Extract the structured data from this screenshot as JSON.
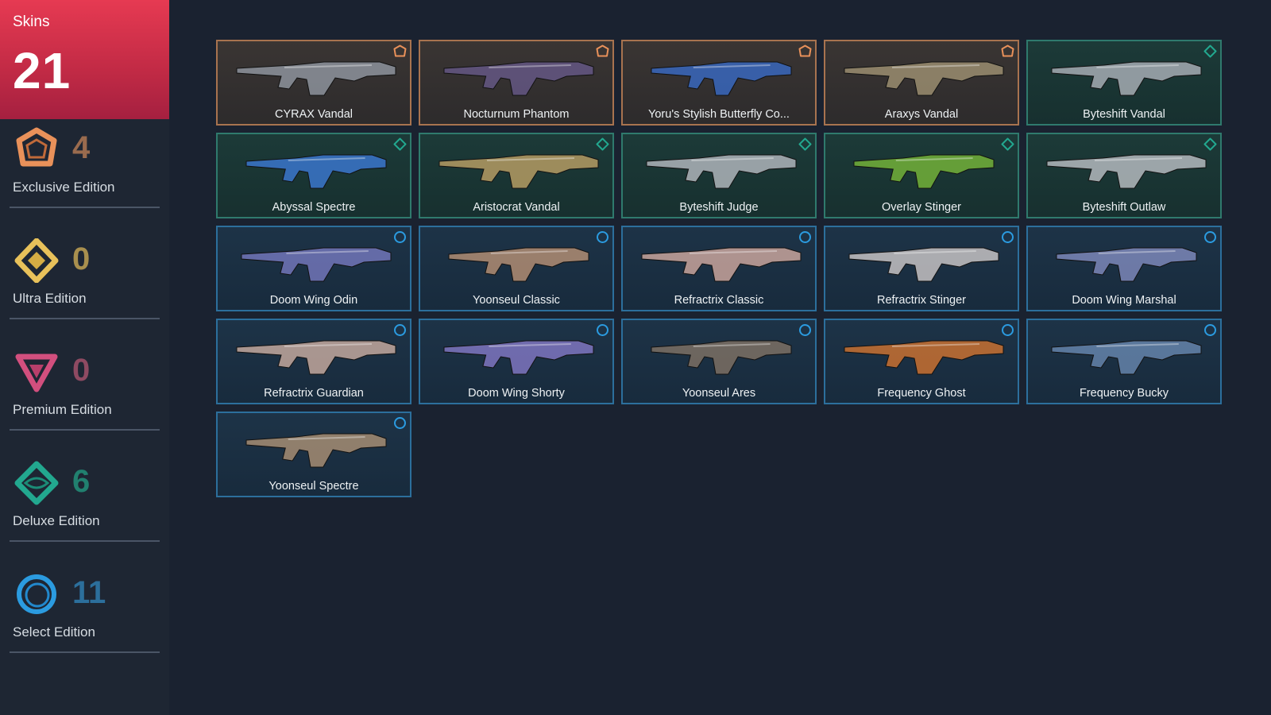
{
  "sidebar": {
    "title": "Skins",
    "total": "21",
    "editions": [
      {
        "name": "Exclusive Edition",
        "count": "4",
        "color": "#e9915a",
        "icon": "exclusive-edition-icon"
      },
      {
        "name": "Ultra Edition",
        "count": "0",
        "color": "#e8c15a",
        "icon": "ultra-edition-icon"
      },
      {
        "name": "Premium Edition",
        "count": "0",
        "color": "#d24f7e",
        "icon": "premium-edition-icon"
      },
      {
        "name": "Deluxe Edition",
        "count": "6",
        "color": "#22a88f",
        "icon": "deluxe-edition-icon"
      },
      {
        "name": "Select Edition",
        "count": "11",
        "color": "#2b9be0",
        "icon": "select-edition-icon"
      }
    ]
  },
  "skins": [
    {
      "name": "CYRAX Vandal",
      "tier": "exclusive",
      "accent": "#9aa0ab"
    },
    {
      "name": "Nocturnum Phantom",
      "tier": "exclusive",
      "accent": "#6b5c8f"
    },
    {
      "name": "Yoru's Stylish Butterfly Co...",
      "tier": "exclusive",
      "accent": "#3a6fd0"
    },
    {
      "name": "Araxys Vandal",
      "tier": "exclusive",
      "accent": "#a89a78"
    },
    {
      "name": "Byteshift Vandal",
      "tier": "deluxe",
      "accent": "#b8bcc4"
    },
    {
      "name": "Abyssal Spectre",
      "tier": "deluxe",
      "accent": "#3f7fe0"
    },
    {
      "name": "Aristocrat Vandal",
      "tier": "deluxe",
      "accent": "#c9a96a"
    },
    {
      "name": "Byteshift Judge",
      "tier": "deluxe",
      "accent": "#c3c6cc"
    },
    {
      "name": "Overlay Stinger",
      "tier": "deluxe",
      "accent": "#7fc23a"
    },
    {
      "name": "Byteshift Outlaw",
      "tier": "deluxe",
      "accent": "#c8cbd0"
    },
    {
      "name": "Doom Wing Odin",
      "tier": "select",
      "accent": "#7d7fc8"
    },
    {
      "name": "Yoonseul Classic",
      "tier": "select",
      "accent": "#c59a7a"
    },
    {
      "name": "Refractrix Classic",
      "tier": "select",
      "accent": "#e0b4a8"
    },
    {
      "name": "Refractrix Stinger",
      "tier": "select",
      "accent": "#dcd6d4"
    },
    {
      "name": "Doom Wing Marshal",
      "tier": "select",
      "accent": "#8a93c8"
    },
    {
      "name": "Refractrix Guardian",
      "tier": "select",
      "accent": "#d9b8aa"
    },
    {
      "name": "Doom Wing Shorty",
      "tier": "select",
      "accent": "#8c7fd0"
    },
    {
      "name": "Yoonseul Ares",
      "tier": "select",
      "accent": "#8a7868"
    },
    {
      "name": "Frequency Ghost",
      "tier": "select",
      "accent": "#e07a2f"
    },
    {
      "name": "Frequency Bucky",
      "tier": "select",
      "accent": "#6f8fb8"
    },
    {
      "name": "Yoonseul Spectre",
      "tier": "select",
      "accent": "#b89a7a"
    }
  ]
}
